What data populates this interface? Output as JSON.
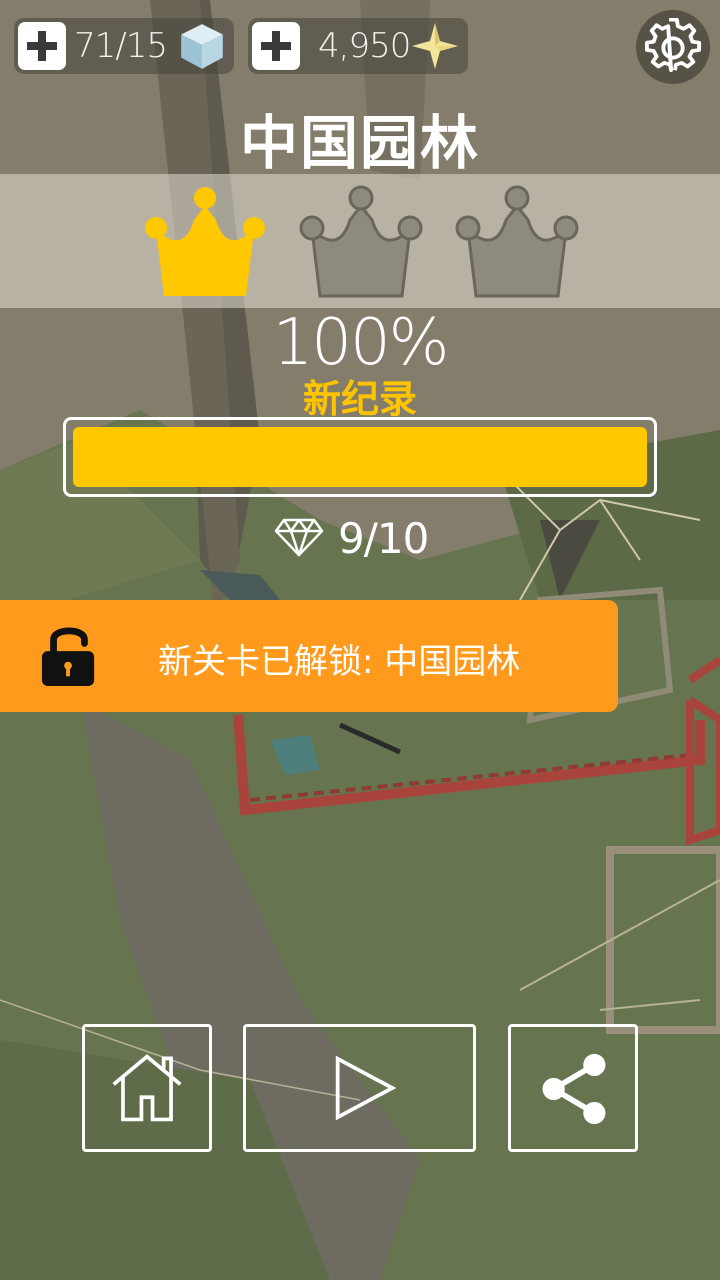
{
  "hud": {
    "cubes_text": "71/15",
    "stars_text": "4,950"
  },
  "level_title": "中国园林",
  "crowns": {
    "earned": 1,
    "total": 3
  },
  "progress": {
    "percent_text": "100%",
    "fraction": 1.0
  },
  "new_record_label": "新纪录",
  "gems_text": "9/10",
  "unlock_banner": {
    "text": "新关卡已解锁: 中国园林"
  },
  "icons": {
    "add_cubes": "plus-icon",
    "cube": "cube-icon",
    "add_stars": "plus-icon",
    "star": "star-icon",
    "settings": "gear-icon",
    "gem": "diamond-icon",
    "lock": "unlocked-padlock-icon",
    "home": "home-icon",
    "play": "play-icon",
    "share": "share-icon"
  },
  "colors": {
    "gold": "#ffc800",
    "crown_empty": "#8e8a80",
    "banner": "#ff9a1c",
    "record_text": "#ffc400"
  }
}
